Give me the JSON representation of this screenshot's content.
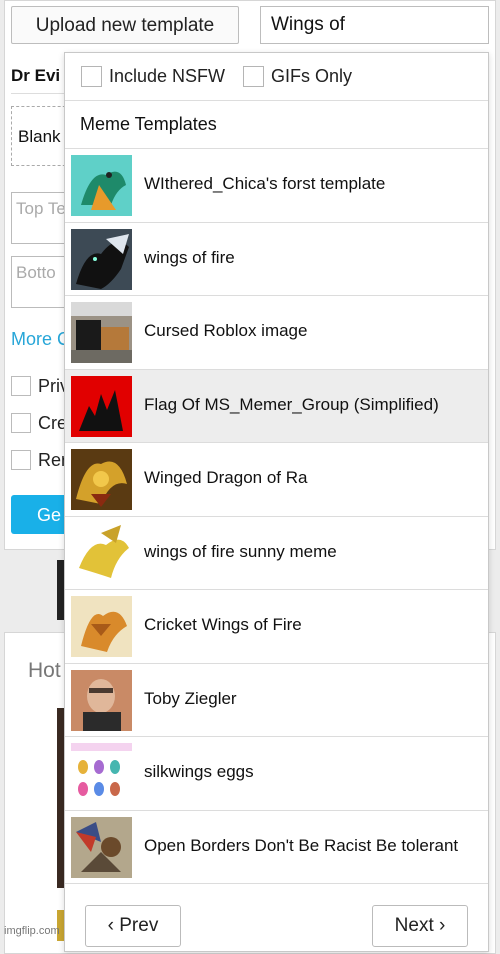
{
  "toolbar": {
    "upload_label": "Upload new template",
    "search_value": "Wings of"
  },
  "background": {
    "selected_template": "Dr Evi",
    "blank_label": "Blank",
    "top_text_placeholder": "Top Te",
    "bottom_text_placeholder": "Botto",
    "more_options": "More C",
    "checkbox_labels": [
      "Priv",
      "Cre",
      "Rer"
    ],
    "generate_label": "Ge",
    "hot_label": "Hot",
    "watermark": "imgflip.com"
  },
  "dropdown": {
    "include_nsfw": "Include NSFW",
    "gifs_only": "GIFs Only",
    "section_title": "Meme Templates",
    "items": [
      {
        "label": "WIthered_Chica's forst template",
        "icon": "teal-dragon-thumb"
      },
      {
        "label": "wings of fire",
        "icon": "dark-dragon-thumb"
      },
      {
        "label": "Cursed Roblox image",
        "icon": "roblox-thumb"
      },
      {
        "label": "Flag Of MS_Memer_Group (Simplified)",
        "icon": "red-flag-thumb"
      },
      {
        "label": "Winged Dragon of Ra",
        "icon": "gold-dragon-card-thumb"
      },
      {
        "label": "wings of fire sunny meme",
        "icon": "yellow-dragon-thumb"
      },
      {
        "label": "Cricket Wings of Fire",
        "icon": "orange-dragon-thumb"
      },
      {
        "label": "Toby Ziegler",
        "icon": "man-portrait-thumb"
      },
      {
        "label": "silkwings eggs",
        "icon": "eggs-thumb"
      },
      {
        "label": "Open Borders Don't Be Racist Be tolerant",
        "icon": "painting-thumb"
      }
    ],
    "highlighted_index": 3,
    "prev_label": "‹ Prev",
    "next_label": "Next ›"
  },
  "colors": {
    "accent": "#19b0e8",
    "link": "#27a6d8",
    "flag_red": "#e10000"
  }
}
